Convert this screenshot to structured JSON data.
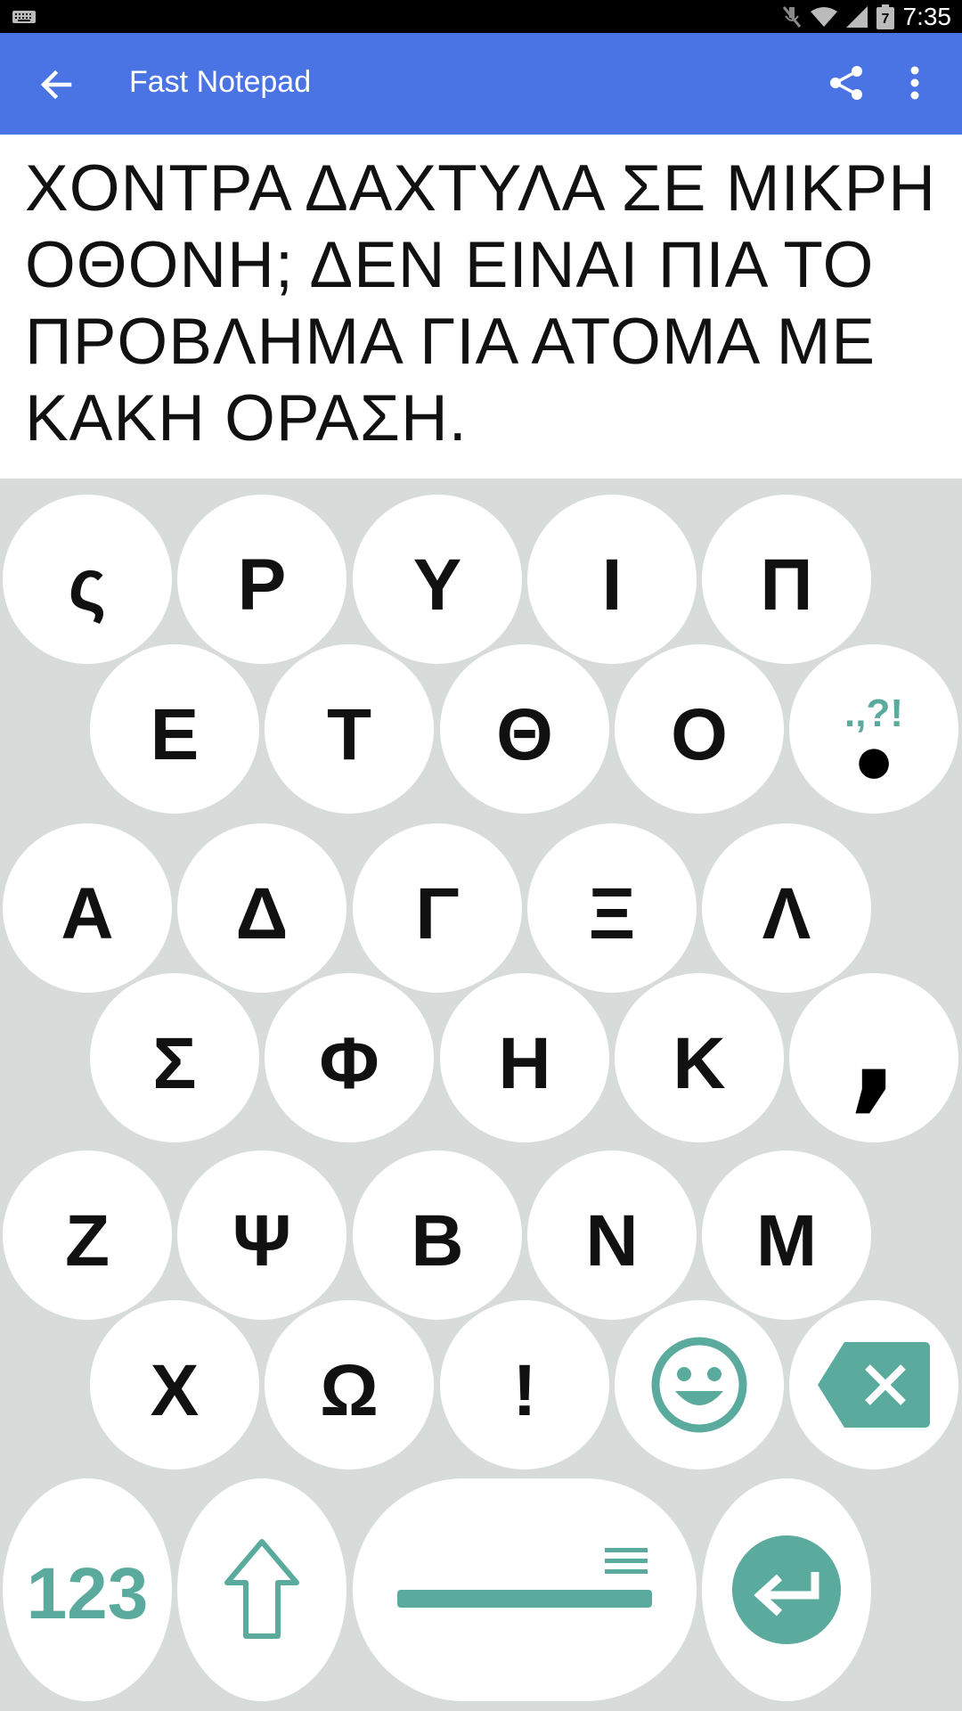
{
  "status_bar": {
    "time": "7:35",
    "icons": [
      "keyboard-icon",
      "mute-icon",
      "wifi-icon",
      "signal-icon",
      "battery-icon"
    ],
    "battery_level": "7"
  },
  "app_bar": {
    "title": "Fast Notepad",
    "icons": [
      "back-arrow-icon",
      "share-icon",
      "more-vert-icon"
    ],
    "color": "#4a73e3"
  },
  "note": {
    "text": "ΧΟΝΤΡΑ ΔΑΧΤΥΛΑ ΣΕ ΜΙΚΡΗ ΟΘΟΝΗ; ΔΕΝ ΕΙΝΑΙ ΠΙΑ ΤΟ ΠΡΟΒΛΗΜΑ ΓΙΑ ΑΤΟΜΑ ΜΕ ΚΑΚΗ ΟΡΑΣΗ."
  },
  "keyboard": {
    "accent_color": "#5aab9e",
    "rows": [
      [
        "ς",
        "Ρ",
        "Υ",
        "Ι",
        "Π"
      ],
      [
        "Ε",
        "Τ",
        "Θ",
        "Ο"
      ],
      [
        "Α",
        "Δ",
        "Γ",
        "Ξ",
        "Λ"
      ],
      [
        "Σ",
        "Φ",
        "Η",
        "Κ"
      ],
      [
        "Ζ",
        "Ψ",
        "Β",
        "Ν",
        "Μ"
      ],
      [
        "Χ",
        "Ω",
        "!"
      ]
    ],
    "punctuation_key": {
      "hint": ".,?!",
      "main": "●"
    },
    "comma_key": ",",
    "numbers_key": "123",
    "special_icons": [
      "emoji-icon",
      "backspace-icon",
      "shift-icon",
      "space-icon",
      "enter-icon"
    ]
  }
}
